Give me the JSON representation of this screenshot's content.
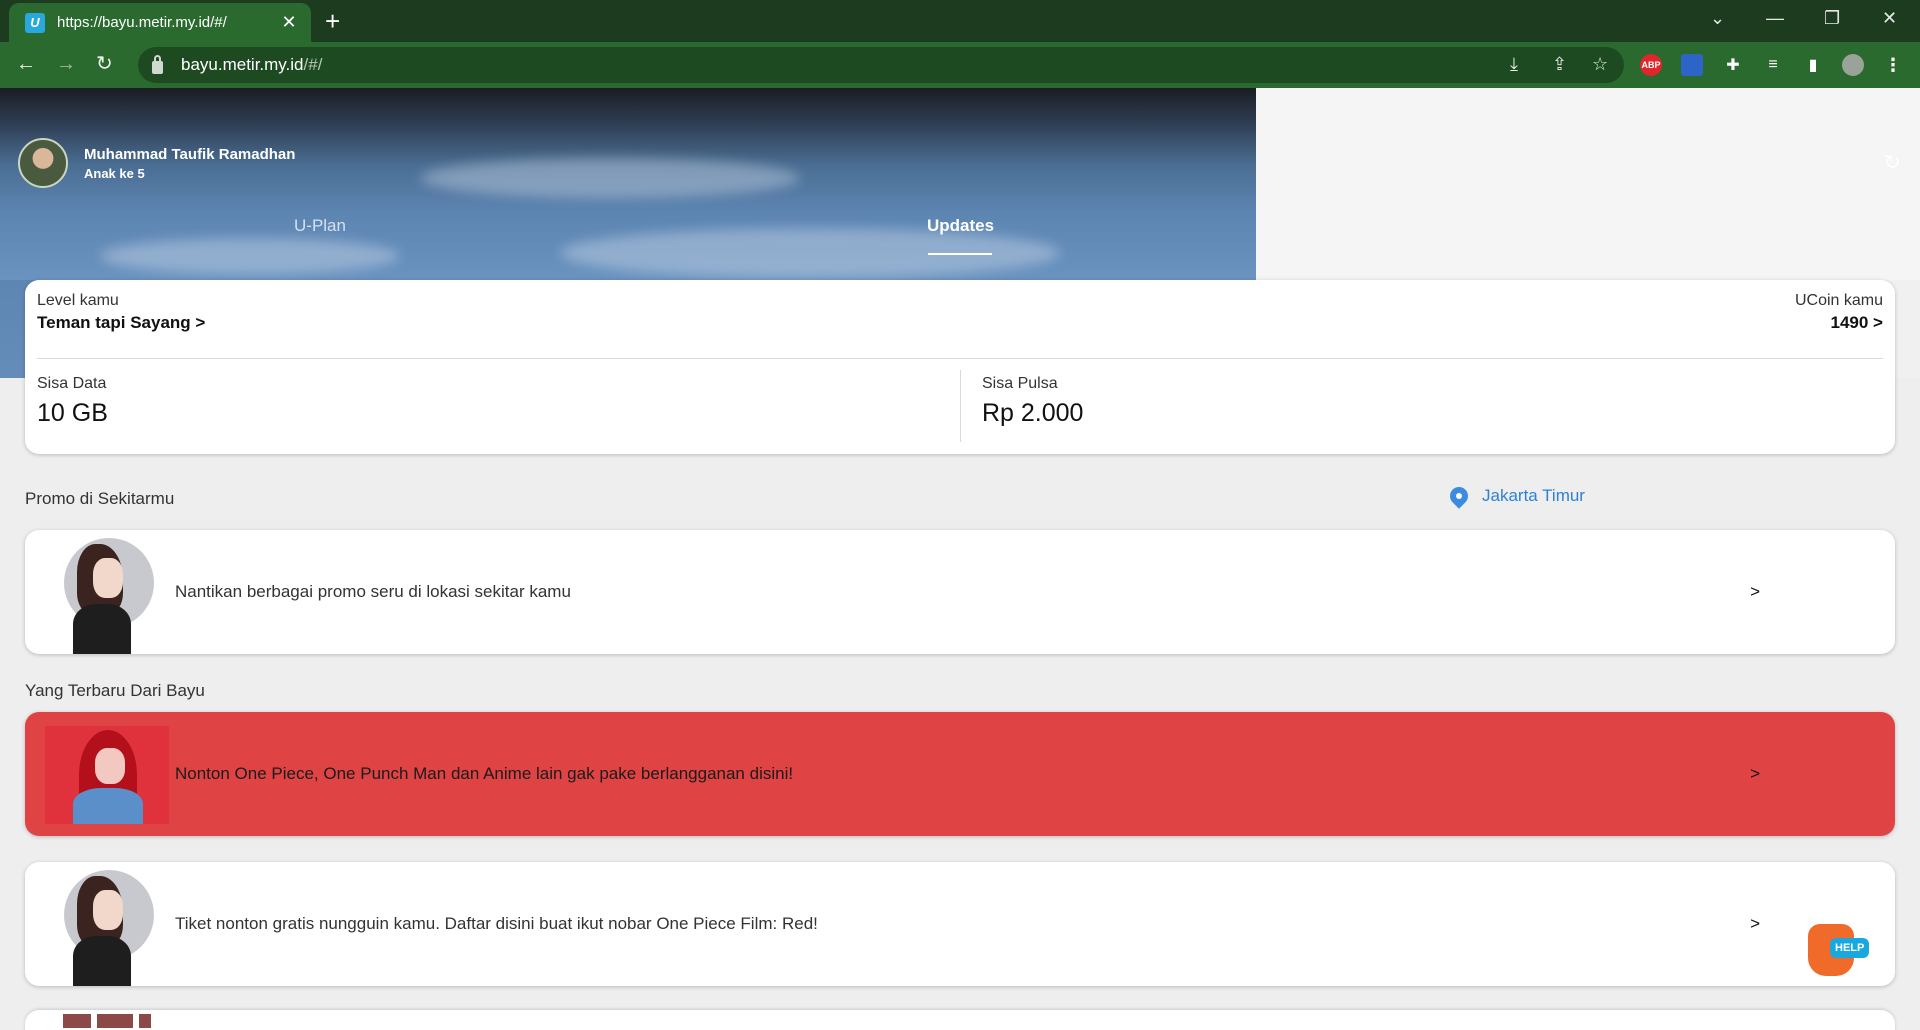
{
  "browser": {
    "tab_title": "https://bayu.metir.my.id/#/",
    "favicon_letter": "U",
    "url_host": "bayu.metir.my.id",
    "url_path": "/#/",
    "extensions": [
      "ABP"
    ]
  },
  "profile": {
    "name": "Muhammad Taufik Ramadhan",
    "subtitle": "Anak ke 5"
  },
  "nav": {
    "tabs": [
      {
        "label": "U-Plan",
        "active": false
      },
      {
        "label": "Updates",
        "active": true
      }
    ]
  },
  "summary": {
    "level_label": "Level kamu",
    "level_value": "Teman tapi Sayang >",
    "ucoin_label": "UCoin kamu",
    "ucoin_value": "1490 >",
    "data_label": "Sisa Data",
    "data_value": "10 GB",
    "pulsa_label": "Sisa Pulsa",
    "pulsa_value": "Rp 2.000"
  },
  "promo": {
    "title": "Promo di Sekitarmu",
    "location": "Jakarta Timur",
    "item_text": "Nantikan berbagai promo seru di lokasi sekitar kamu",
    "arrow": ">"
  },
  "updates": {
    "title": "Yang Terbaru Dari Bayu",
    "items": [
      {
        "text": "Nonton One Piece, One Punch Man dan Anime lain gak pake berlangganan disini!",
        "arrow": ">",
        "color": "#df4344"
      },
      {
        "text": "Tiket nonton gratis nungguin kamu. Daftar disini buat ikut nobar One Piece Film: Red!",
        "arrow": ">"
      }
    ]
  },
  "help": {
    "label": "HELP"
  },
  "colors": {
    "chrome_dark": "#1c3b1f",
    "chrome": "#2b6a2f",
    "accent_red": "#df4344",
    "link_blue": "#2f80d6"
  }
}
